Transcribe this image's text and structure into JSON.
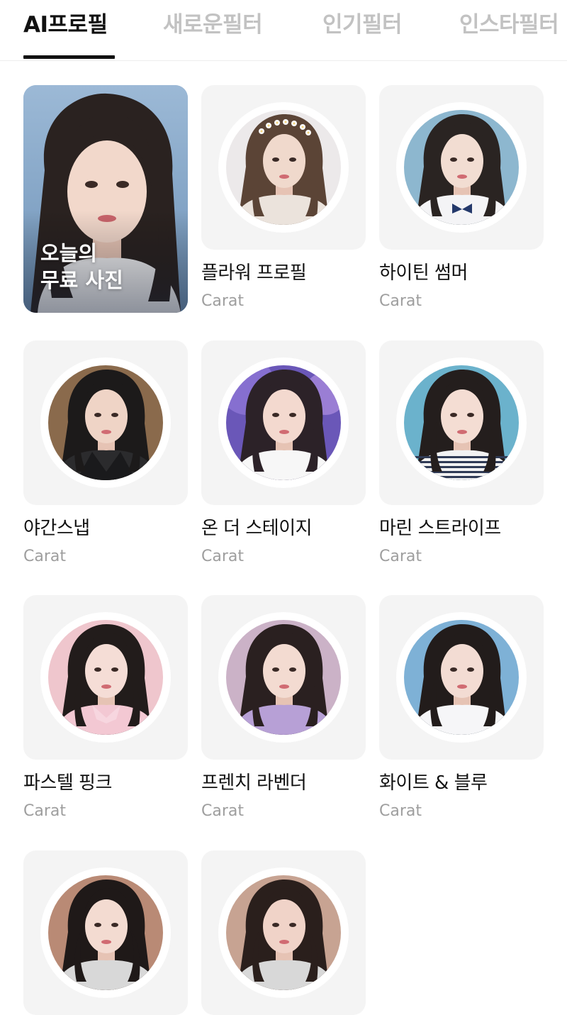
{
  "tabs": [
    {
      "label": "AI프로필",
      "active": true
    },
    {
      "label": "새로운필터",
      "active": false
    },
    {
      "label": "인기필터",
      "active": false
    },
    {
      "label": "인스타필터",
      "active": false
    }
  ],
  "featured": {
    "line1": "오늘의",
    "line2": "무료 사진"
  },
  "items": [
    {
      "title": "플라워 프로필",
      "subtitle": "Carat",
      "bg": "#ece9ea",
      "hair": "#5b4436",
      "skin": "#f0d9cc",
      "top": "#ebe3dc",
      "accessory": "flower-crown"
    },
    {
      "title": "하이틴 썸머",
      "subtitle": "Carat",
      "bg": "#8db7cf",
      "hair": "#2a2422",
      "skin": "#f2ddd2",
      "top": "#f4f4f6",
      "accessory": "navy-bow"
    },
    {
      "title": "야간스냅",
      "subtitle": "Carat",
      "bg": "#8a6a4c",
      "hair": "#1c1a1a",
      "skin": "#efd4c6",
      "top": "#2b2b2d",
      "accessory": "leather-jacket"
    },
    {
      "title": "온 더 스테이지",
      "subtitle": "Carat",
      "bg": "#6a57b8",
      "hair": "#2c2228",
      "skin": "#f3d9cf",
      "top": "#f7f7f7",
      "accessory": "stage-lights"
    },
    {
      "title": "마린 스트라이프",
      "subtitle": "Carat",
      "bg": "#6bb2cc",
      "hair": "#241e1d",
      "skin": "#f4ddd3",
      "top": "#f2f2f2",
      "accessory": "stripes"
    },
    {
      "title": "파스텔 핑크",
      "subtitle": "Carat",
      "bg": "#efc6cd",
      "hair": "#221c1b",
      "skin": "#f5ddd6",
      "top": "#f3c8d3",
      "accessory": "collar"
    },
    {
      "title": "프렌치 라벤더",
      "subtitle": "Carat",
      "bg": "#cbb2c7",
      "hair": "#2a2020",
      "skin": "#f3dbd1",
      "top": "#b7a0d6",
      "accessory": "none"
    },
    {
      "title": "화이트 & 블루",
      "subtitle": "Carat",
      "bg": "#7eb1d6",
      "hair": "#221c1b",
      "skin": "#f3dcd3",
      "top": "#f6f6f8",
      "accessory": "none"
    },
    {
      "title": "",
      "subtitle": "",
      "bg": "#b98a75",
      "hair": "#1f1918",
      "skin": "#f3dbd1",
      "top": "#d8d8d8",
      "accessory": "none"
    },
    {
      "title": "",
      "subtitle": "",
      "bg": "#c7a392",
      "hair": "#2a1f1c",
      "skin": "#f0d3c8",
      "top": "#d8d8d8",
      "accessory": "none"
    }
  ]
}
